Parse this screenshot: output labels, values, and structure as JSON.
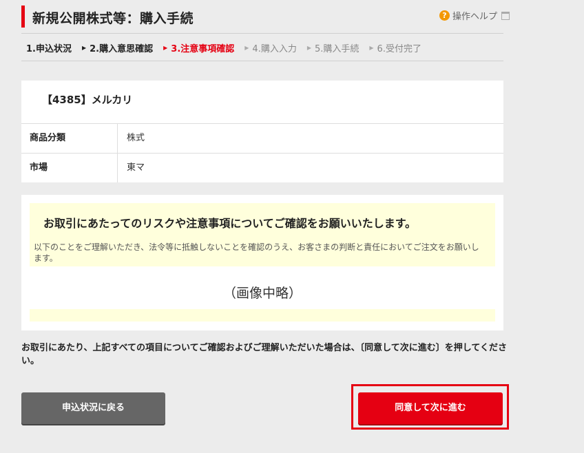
{
  "header": {
    "title": "新規公開株式等：購入手続",
    "help_label": "操作ヘルプ"
  },
  "steps": [
    {
      "label": "1.申込状況",
      "state": "done"
    },
    {
      "label": "2.購入意思確認",
      "state": "done"
    },
    {
      "label": "3.注意事項確認",
      "state": "current"
    },
    {
      "label": "4.購入入力",
      "state": "todo"
    },
    {
      "label": "5.購入手続",
      "state": "todo"
    },
    {
      "label": "6.受付完了",
      "state": "todo"
    }
  ],
  "stock": {
    "name": "【4385】メルカリ",
    "rows": [
      {
        "key": "商品分類",
        "value": "株式"
      },
      {
        "key": "市場",
        "value": "東マ"
      }
    ]
  },
  "notice": {
    "heading": "お取引にあたってのリスクや注意事項についてご確認をお願いいたします。",
    "body": "以下のことをご理解いただき、法令等に抵触しないことを確認のうえ、お客さまの判断と責任においてご注文をお願いします。",
    "omitted": "（画像中略）"
  },
  "confirm_text": "お取引にあたり、上記すべての項目についてご確認およびご理解いただいた場合は、〔同意して次に進む〕を押してください。",
  "buttons": {
    "back": "申込状況に戻る",
    "next": "同意して次に進む"
  },
  "colors": {
    "accent": "#e50012",
    "notice_bg": "#ffffdc",
    "back_button": "#666666",
    "help_icon": "#f39800"
  }
}
